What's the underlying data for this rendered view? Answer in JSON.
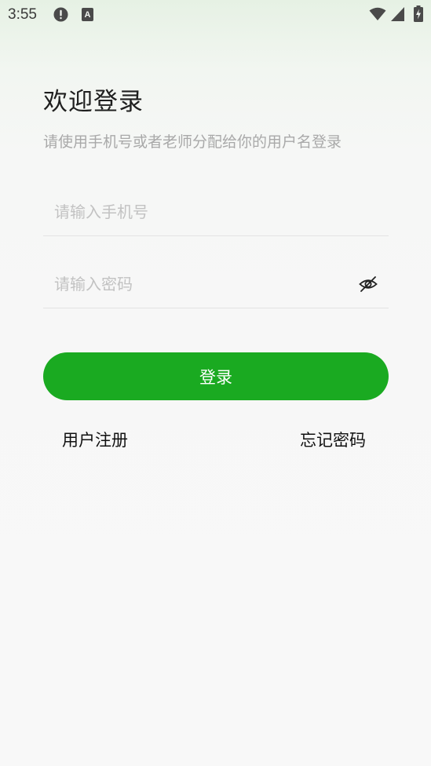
{
  "status_bar": {
    "time": "3:55",
    "icons": [
      "alert-icon",
      "a-notification-icon",
      "wifi-icon",
      "signal-icon",
      "battery-charging-icon"
    ],
    "a_icon_letter": "A"
  },
  "login": {
    "title": "欢迎登录",
    "subtitle": "请使用手机号或者老师分配给你的用户名登录",
    "phone_placeholder": "请输入手机号",
    "phone_value": "",
    "password_placeholder": "请输入密码",
    "password_value": "",
    "submit_label": "登录",
    "register_label": "用户注册",
    "forgot_label": "忘记密码"
  },
  "colors": {
    "accent": "#1aaa21",
    "placeholder": "#c2c2c2",
    "subtitle": "#a9a9a9",
    "background_top": "#e6f1e4"
  }
}
